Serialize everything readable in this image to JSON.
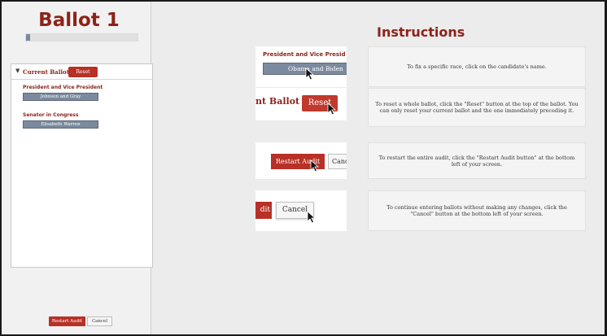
{
  "sidebar": {
    "ballot_title": "Ballot 1",
    "progress_fraction": 0.04,
    "current_ballot_label": "Current Ballot",
    "reset_label": "Reset",
    "races": [
      {
        "title": "President and Vice President",
        "candidate": "Johnson and Gray"
      },
      {
        "title": "Senator in Congress",
        "candidate": "Elisabeth Warren"
      }
    ],
    "restart_audit_label": "Restart Audit",
    "cancel_label": "Cancel"
  },
  "main": {
    "instructions_title": "Instructions",
    "steps": [
      {
        "shot_race": "President and Vice Presid",
        "shot_candidate": "Obama and Biden",
        "text": "To fix a specific race, click on the candidate's name."
      },
      {
        "shot_text": "nt Ballot",
        "shot_button": "Reset",
        "text": "To reset a whole ballot, click the \"Reset\" button at the top of the ballot. You can only reset your current ballot and the one immediately preceding it."
      },
      {
        "shot_restart": "Restart Audit",
        "shot_cancel": "Canc",
        "text": "To restart the entire audit, click the \"Restart Audit button\" at the bottom left of your screen."
      },
      {
        "shot_restart": "dit",
        "shot_cancel": "Cancel",
        "text": "To continue entering ballots without making any changes, click the \"Cancel\" button at the bottom left of your screen."
      }
    ]
  }
}
